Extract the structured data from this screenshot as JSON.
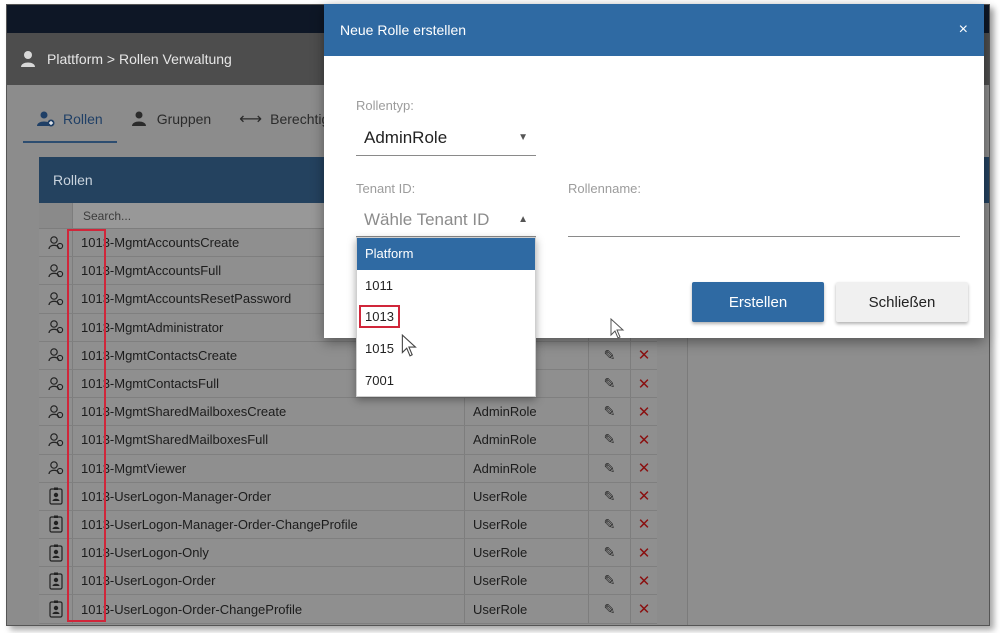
{
  "breadcrumb": "Plattform > Rollen Verwaltung",
  "tabs": [
    {
      "label": "Rollen",
      "active": true
    },
    {
      "label": "Gruppen",
      "active": false
    },
    {
      "label": "Berechtigungen",
      "active": false
    }
  ],
  "panel": {
    "title": "Rollen",
    "search_placeholder": "Search..."
  },
  "rows": [
    {
      "icon": "user-group-icon",
      "name": "1013-MgmtAccountsCreate",
      "type": ""
    },
    {
      "icon": "user-group-icon",
      "name": "1013-MgmtAccountsFull",
      "type": ""
    },
    {
      "icon": "user-group-icon",
      "name": "1013-MgmtAccountsResetPassword",
      "type": ""
    },
    {
      "icon": "user-group-icon",
      "name": "1013-MgmtAdministrator",
      "type": ""
    },
    {
      "icon": "user-group-icon",
      "name": "1013-MgmtContactsCreate",
      "type": ""
    },
    {
      "icon": "user-group-icon",
      "name": "1013-MgmtContactsFull",
      "type": ""
    },
    {
      "icon": "user-group-icon",
      "name": "1013-MgmtSharedMailboxesCreate",
      "type": "AdminRole"
    },
    {
      "icon": "user-group-icon",
      "name": "1013-MgmtSharedMailboxesFull",
      "type": "AdminRole"
    },
    {
      "icon": "user-group-icon",
      "name": "1013-MgmtViewer",
      "type": "AdminRole"
    },
    {
      "icon": "id-badge-icon",
      "name": "1013-UserLogon-Manager-Order",
      "type": "UserRole"
    },
    {
      "icon": "id-badge-icon",
      "name": "1013-UserLogon-Manager-Order-ChangeProfile",
      "type": "UserRole"
    },
    {
      "icon": "id-badge-icon",
      "name": "1013-UserLogon-Only",
      "type": "UserRole"
    },
    {
      "icon": "id-badge-icon",
      "name": "1013-UserLogon-Order",
      "type": "UserRole"
    },
    {
      "icon": "id-badge-icon",
      "name": "1013-UserLogon-Order-ChangeProfile",
      "type": "UserRole"
    }
  ],
  "modal": {
    "title": "Neue Rolle erstellen",
    "close_label": "×",
    "rollentyp_label": "Rollentyp:",
    "rollentyp_value": "AdminRole",
    "tenant_label": "Tenant ID:",
    "tenant_placeholder": "Wähle Tenant ID",
    "rollenname_label": "Rollenname:",
    "create_button": "Erstellen",
    "close_button": "Schließen"
  },
  "dropdown_options": [
    "Platform",
    "1011",
    "1013",
    "1015",
    "7001"
  ],
  "dropdown_selected": "Platform",
  "dropdown_marked": "1013",
  "colors": {
    "accent": "#2f6aa3",
    "highlight": "#d0263a",
    "delete": "#8a1010"
  }
}
